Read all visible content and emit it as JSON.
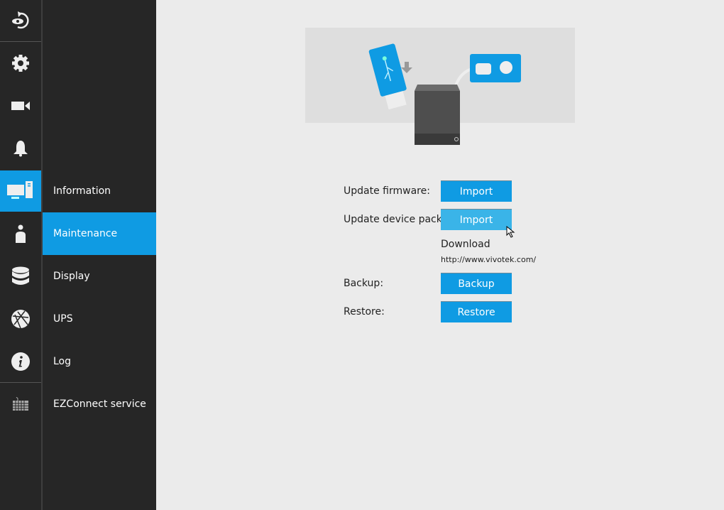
{
  "rail": {
    "items": [
      {
        "name": "back-icon"
      },
      {
        "name": "gear-icon"
      },
      {
        "name": "camera-icon"
      },
      {
        "name": "bell-icon"
      },
      {
        "name": "computer-icon",
        "active": true
      },
      {
        "name": "user-icon"
      },
      {
        "name": "database-icon"
      },
      {
        "name": "globe-icon"
      },
      {
        "name": "info-icon"
      },
      {
        "name": "keyboard-icon"
      }
    ]
  },
  "submenu": {
    "items": [
      {
        "label": "Information"
      },
      {
        "label": "Maintenance",
        "active": true
      },
      {
        "label": "Display"
      },
      {
        "label": "UPS"
      },
      {
        "label": "Log"
      },
      {
        "label": "EZConnect service"
      }
    ]
  },
  "form": {
    "update_firmware_label": "Update firmware:",
    "update_firmware_button": "Import",
    "update_device_pack_label": "Update device pack:",
    "update_device_pack_button": "Import",
    "download_label": "Download",
    "download_url": "http://www.vivotek.com/",
    "backup_label": "Backup:",
    "backup_button": "Backup",
    "restore_label": "Restore:",
    "restore_button": "Restore"
  },
  "colors": {
    "accent": "#0f9be3",
    "hover": "#3ab4e8",
    "sidebar": "#262626",
    "background": "#ebebeb"
  }
}
